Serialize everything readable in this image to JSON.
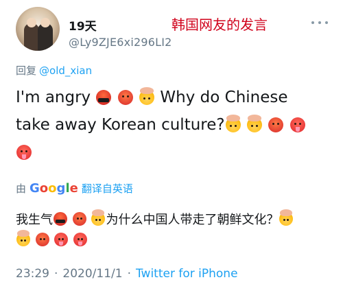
{
  "header": {
    "display_name": "19天",
    "handle": "@Ly9ZJE6xi296LI2",
    "annotation": "韩国网友的发言"
  },
  "reply": {
    "prefix": "回复",
    "mention": "@old_xian"
  },
  "tweet": {
    "line1_a": "I'm angry",
    "line1_b": "Why do Chinese",
    "line2": "take away Korean culture?",
    "emojis": [
      "cursing-face",
      "angry-face",
      "exploding-head",
      "exploding-head",
      "exploding-head",
      "angry-face",
      "hot-face",
      "hot-face"
    ]
  },
  "translation": {
    "by_label": "由",
    "provider": "Google",
    "link_label": "翻译自英语",
    "text_a": "我生气",
    "text_b": "为什么中国人带走了朝鲜文化？"
  },
  "meta": {
    "time": "23:29",
    "dot": "·",
    "date": "2020/11/1",
    "source": "Twitter for iPhone"
  },
  "colors": {
    "link": "#1da1f2",
    "secondary": "#657786",
    "annotation": "#d0021b"
  }
}
